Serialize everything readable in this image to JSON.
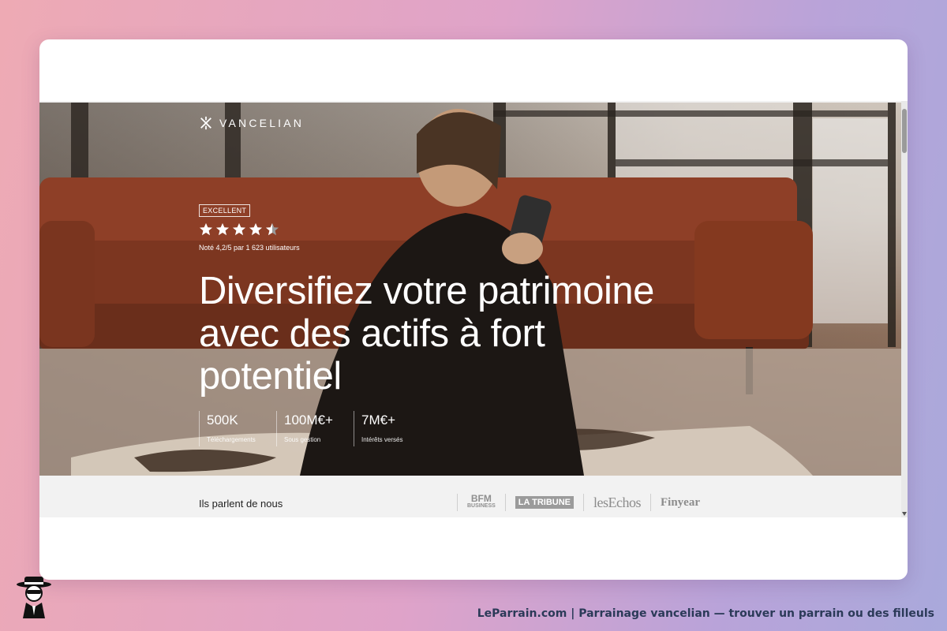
{
  "brand": {
    "name": "VANCELIAN"
  },
  "rating": {
    "badge": "EXCELLENT",
    "stars": 4.5,
    "max": 5,
    "text": "Noté 4,2/5 par 1 623 utilisateurs"
  },
  "hero": {
    "headline": "Diversifiez votre patrimoine avec des actifs à fort potentiel"
  },
  "stats": [
    {
      "value": "500K",
      "label": "Téléchargements"
    },
    {
      "value": "100M€+",
      "label": "Sous gestion"
    },
    {
      "value": "7M€+",
      "label": "Intérêts versés"
    }
  ],
  "press": {
    "title": "Ils parlent de nous",
    "logos": [
      {
        "main": "BFM",
        "sub": "BUSINESS"
      },
      {
        "main": "LA TRIBUNE"
      },
      {
        "main": "lesEchos"
      },
      {
        "main": "Finyear"
      }
    ]
  },
  "footer": {
    "caption": "LeParrain.com | Parrainage vancelian — trouver un parrain ou des filleuls"
  },
  "colors": {
    "accent_bg": "#e8a6c7",
    "hero_text": "#ffffff",
    "press_bg": "#f2f2f2"
  }
}
